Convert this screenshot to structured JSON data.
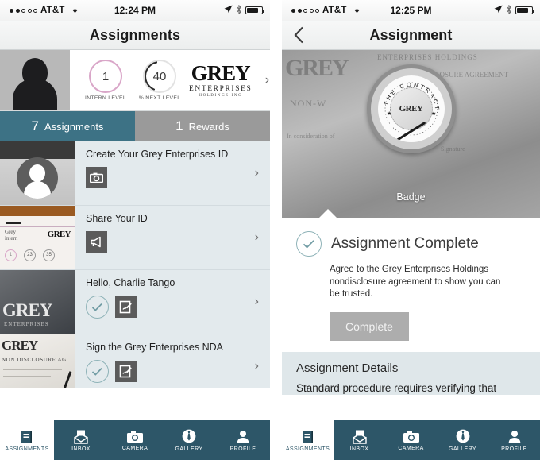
{
  "left_phone": {
    "statusbar": {
      "carrier": "AT&T",
      "time": "12:24 PM",
      "signal_dots_filled": 2,
      "signal_dots_total": 5,
      "icons": [
        "location-arrow-icon",
        "bluetooth-icon",
        "battery-icon"
      ]
    },
    "navbar": {
      "title": "Assignments"
    },
    "profile": {
      "avatar_alt": "user-avatar-silhouette",
      "level_value": "1",
      "level_label": "INTERN LEVEL",
      "next_value": "40",
      "next_label": "% NEXT LEVEL",
      "logo_main": "GREY",
      "logo_sub1": "ENTERPRISES",
      "logo_sub2": "HOLDINGS INC",
      "chevron": "›"
    },
    "segmented_tabs": [
      {
        "count": "7",
        "label": "Assignments",
        "active": true
      },
      {
        "count": "1",
        "label": "Rewards",
        "active": false
      }
    ],
    "assignments": [
      {
        "title": "Create Your Grey Enterprises ID",
        "icons": [
          "camera-icon"
        ],
        "thumb": "id-badge-photo",
        "chevron": "›"
      },
      {
        "title": "Share Your ID",
        "icons": [
          "megaphone-icon"
        ],
        "thumb": "grey-intern-card-photo",
        "chevron": "›"
      },
      {
        "title": "Hello, Charlie Tango",
        "icons": [
          "check-circle-icon",
          "sign-document-icon"
        ],
        "thumb": "grey-enterprises-sign-photo",
        "chevron": "›"
      },
      {
        "title": "Sign the Grey Enterprises NDA",
        "icons": [
          "check-circle-icon",
          "sign-document-icon"
        ],
        "thumb": "nda-document-photo",
        "chevron": "›"
      }
    ],
    "tabbar": [
      {
        "label": "ASSIGNMENTS",
        "icon": "notebook-icon",
        "active": true
      },
      {
        "label": "INBOX",
        "icon": "envelope-icon",
        "active": false
      },
      {
        "label": "CAMERA",
        "icon": "camera-icon",
        "active": false
      },
      {
        "label": "GALLERY",
        "icon": "necktie-icon",
        "active": false
      },
      {
        "label": "PROFILE",
        "icon": "person-icon",
        "active": false
      }
    ]
  },
  "right_phone": {
    "statusbar": {
      "carrier": "AT&T",
      "time": "12:25 PM",
      "signal_dots_filled": 2,
      "signal_dots_total": 5
    },
    "navbar": {
      "title": "Assignment",
      "back": "‹"
    },
    "hero": {
      "badge_seal_top_text": "THE CONTRACT",
      "badge_core_text": "GREY",
      "badge_label": "Badge",
      "background_alt": "nda-contract-document-photo"
    },
    "complete": {
      "title": "Assignment Complete",
      "description": "Agree to the Grey Enterprises Holdings nondisclosure agreement to show you can be trusted.",
      "button_label": "Complete",
      "check_icon": "check-circle-icon"
    },
    "details": {
      "title": "Assignment Details",
      "body": "Standard procedure requires verifying that"
    },
    "tabbar": [
      {
        "label": "ASSIGNMENTS",
        "icon": "notebook-icon",
        "active": true
      },
      {
        "label": "INBOX",
        "icon": "envelope-icon",
        "active": false
      },
      {
        "label": "CAMERA",
        "icon": "camera-icon",
        "active": false
      },
      {
        "label": "GALLERY",
        "icon": "necktie-icon",
        "active": false
      },
      {
        "label": "PROFILE",
        "icon": "person-icon",
        "active": false
      }
    ]
  },
  "colors": {
    "tabbar_bg": "#2d5668",
    "segtab_active": "#3d7285",
    "segtab_inactive": "#9a9a9a",
    "list_bg": "#e3eaed",
    "details_bg": "#dfe7ea",
    "button_bg": "#adadad",
    "ring_pink": "#d9a6c8",
    "check_stroke": "#6f9ba3"
  }
}
